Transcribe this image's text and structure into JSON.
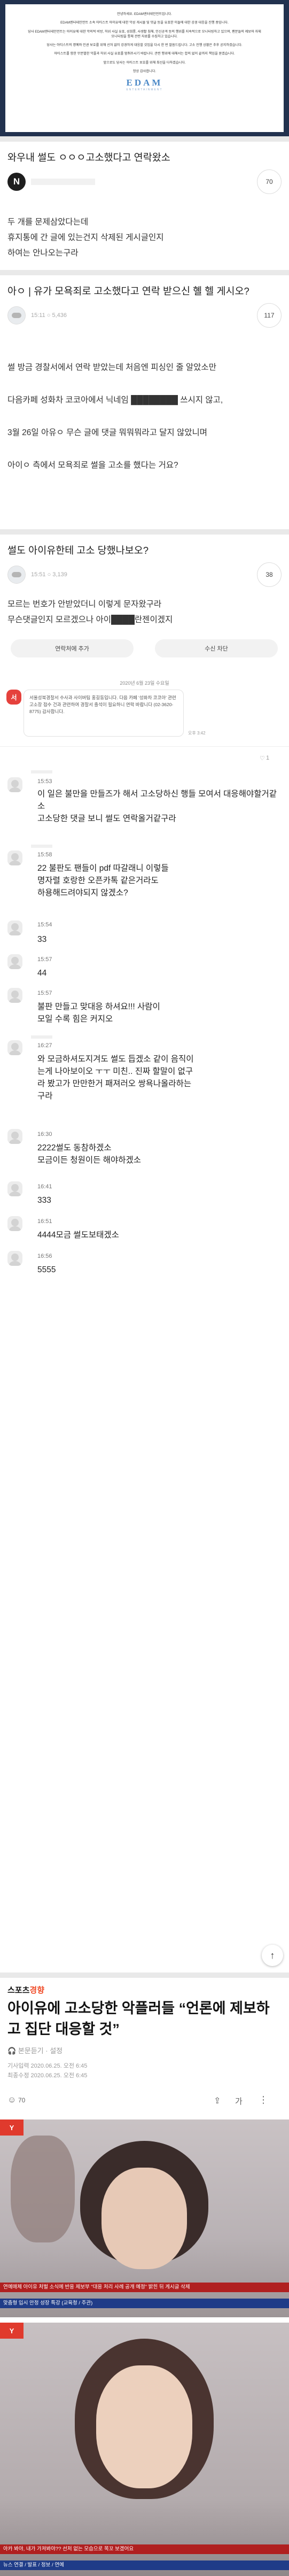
{
  "notice": {
    "paragraphs": [
      "안녕하세요. EDAM엔터테인먼트입니다.",
      "EDAM엔터테인먼트 소속 아티스트 아이유에 대한 악성 게시물 및 댓글 등을 유포한 이들에 대한 강경 대응을 진행 중입니다.",
      "당사 EDAM엔터테인먼트는 아이유에 대한 악의적 비방, 허위 사실 유포, 성희롱, 사생활 침해, 인신공격 등의 행위를 지속적으로 모니터링하고 있으며, 팬분들의 제보와 자체 모니터링을 통해 관련 자료를 수집하고 있습니다.",
      "당사는 아티스트의 명예와 인권 보호를 위해 선처 없이 강경하게 대응할 것임을 다시 한 번 말씀드립니다. 고소 진행 상황은 추후 공지하겠습니다.",
      "아티스트를 향한 무분별한 악플과 허위 사실 유포를 멈춰주시기 바랍니다. 관련 행위에 대해서는 합의 없이 끝까지 책임을 묻겠습니다.",
      "앞으로도 당사는 아티스트 보호를 위해 최선을 다하겠습니다.",
      "항상 감사합니다."
    ],
    "logo": "EDAM",
    "logo_sub": "ENTERTAINMENT"
  },
  "post1": {
    "title": "와우내 썰도 ㅇㅇㅇ고소했다고 연락왔소",
    "avatar_letter": "N",
    "replies": "70",
    "body": [
      "두 개를 문제삼았다는데",
      "휴지통에 간 글에 있는건지 삭제된 게시글인지",
      "하여는 안나오는구라"
    ]
  },
  "post2": {
    "title": "아ㅇ | 유가 모욕죄로 고소했다고 연락 받으신 혤 헬 게시오?",
    "meta": "15:11   ○ 5,436",
    "replies": "117",
    "body": [
      "썰 방금 경찰서에서 연락 받았는데 처음엔 피싱인 줄 알았소만",
      "다음카페 성화차 코코아에서 닉네임 ████████ 쓰시지 않고,",
      "3월 26일 아유ㅇ 무슨 글에 댓글 뭐뭐뭐라고 달지 않았니며",
      "아이ㅇ 측에서 모욕죄로 썰을 고소를 했다는 거요?"
    ]
  },
  "post3": {
    "title": "썰도 아이유한테 고소 당했나보오?",
    "meta": "15:51   ○ 3,139",
    "replies": "38",
    "body": [
      "모르는 번호가 안받았더니 이렇게 문자왔구라",
      "무슨댓글인지 모르겠으나 아이████란젠이겠지"
    ]
  },
  "kakao": {
    "btn_left": "연락처에 추가",
    "btn_right": "수신 차단",
    "date": "2020년 6월 23일 수요일",
    "bubble": "서울성북경찰서 수사과 사이버팀 홍길동입니다. 다음 카페 '성화차 코코아' 관련 고소장 접수 건과 관련하여 경찰서 출석이 필요하니 연락 바랍니다 (02-3620-8775) 감사합니다.",
    "bubble_time": "오후 3:42",
    "avatar": "서"
  },
  "comments": [
    {
      "name": "익명",
      "time": "",
      "text": "",
      "likes": "1"
    },
    {
      "name": "익명",
      "time": "15:53",
      "text": "이 일은 불만을 만들즈가 해서 고소당하신 행들 모여서 대응해야할거같소\n고소당한 댓글 보니 썰도 연락올거같구라",
      "likes": ""
    },
    {
      "name": "익명",
      "time": "15:58",
      "text": "22 불판도 팬들이 pdf 따갈래니 이렇들\n명자렬 호랑한 오픈카톡 같은거라도\n하용해드려야되지 않겠소?",
      "likes": ""
    },
    {
      "name": "익명",
      "time": "15:54",
      "text": "33",
      "likes": ""
    },
    {
      "name": "익명",
      "time": "15:57",
      "text": "44",
      "likes": ""
    },
    {
      "name": "익명",
      "time": "15:57",
      "text": "불판 만들고 맞대응 하셔요!!! 사람이\n모일 수록 힘은 커지오",
      "likes": ""
    },
    {
      "name": "익명",
      "time": "16:27",
      "text": "와 모금하셔도지겨도 썰도 듭겠소 같이 음직이\n는게 나아보이오 ㅜㅜ 미친.. 진짜 할말이 없구\n라 봤고가 만만한거 패져러오 쌍욕나올라하는\n구라",
      "likes": ""
    },
    {
      "name": "익명",
      "time": "16:30",
      "text": "2222썰도 동참하겠소\n모금이든 청원이든 해야하겠소",
      "likes": ""
    },
    {
      "name": "익명",
      "time": "16:41",
      "text": "333",
      "likes": ""
    },
    {
      "name": "익명",
      "time": "16:51",
      "text": "4444모금 썰도보태겠소",
      "likes": ""
    },
    {
      "name": "익명",
      "time": "16:56",
      "text": "5555",
      "likes": ""
    }
  ],
  "article": {
    "brand_prefix": "스포츠",
    "brand_suffix": "경향",
    "title": "아이유에 고소당한 악플러들 “언론에 제보하고 집단 대응할 것”",
    "sub": "🎧 본문듣기 · 설정",
    "input_date": "기사입력 2020.06.25. 오전 6:45",
    "edit_date": "최종수정 2020.06.25. 오전 6:45",
    "like_count": "70",
    "font_tool": "가",
    "news_caption_1": "연예매체 아이유 처벌 소식에 반응 제보부 \"대응 처리 사례 공개 예정\" 밝힌 뒤 게시글 삭제",
    "news_caption_2": "아카 봐야, 내가 가져봐야?? 선처 없는 모습으로 목꼬 보겠어요",
    "ticker_1": "맞춤형 입시 안정 성장 특강 (교육청 / 주관)",
    "ticker_2": "뉴스 연결 / 발표 / 정보 / 연예"
  },
  "colors": {
    "notice_bg": "#22324f",
    "brand_red": "#f04a26",
    "news_red": "#b02020"
  }
}
